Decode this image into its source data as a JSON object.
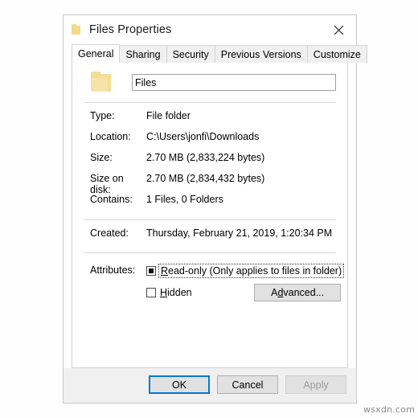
{
  "window": {
    "title": "Files Properties",
    "icon": "folder-icon",
    "close_label": "✕"
  },
  "tabs": [
    {
      "label": "General",
      "active": true
    },
    {
      "label": "Sharing",
      "active": false
    },
    {
      "label": "Security",
      "active": false
    },
    {
      "label": "Previous Versions",
      "active": false
    },
    {
      "label": "Customize",
      "active": false
    }
  ],
  "general": {
    "folder_name_value": "Files",
    "folder_name_placeholder": "",
    "properties": [
      {
        "label": "Type:",
        "value": "File folder"
      },
      {
        "label": "Location:",
        "value": "C:\\Users\\jonfi\\Downloads"
      },
      {
        "label": "Size:",
        "value": "2.70 MB (2,833,224 bytes)"
      },
      {
        "label": "Size on disk:",
        "value": "2.70 MB (2,834,432 bytes)"
      },
      {
        "label": "Contains:",
        "value": "1 Files, 0 Folders"
      }
    ],
    "created": {
      "label": "Created:",
      "value": "Thursday, February 21, 2019, 1:20:34 PM"
    },
    "attributes": {
      "label": "Attributes:",
      "readonly": {
        "label_prefix": "R",
        "label_rest": "ead-only (Only applies to files in folder)",
        "state": "indeterminate",
        "focused": true
      },
      "hidden": {
        "label_prefix": "H",
        "label_rest": "idden",
        "state": "unchecked",
        "focused": false
      },
      "advanced_prefix": "A",
      "advanced_mid": "d",
      "advanced_rest": "vanced..."
    }
  },
  "footer": {
    "ok_label": "OK",
    "cancel_label": "Cancel",
    "apply_label": "Apply",
    "apply_enabled": false
  },
  "watermark": {
    "text": "wsxdn.com"
  },
  "colors": {
    "accent": "#0078d7",
    "folder": "#f4dd94",
    "button_face": "#e1e1e1",
    "panel_border": "#d4d4d4",
    "disabled_text": "#9a9a9a"
  }
}
